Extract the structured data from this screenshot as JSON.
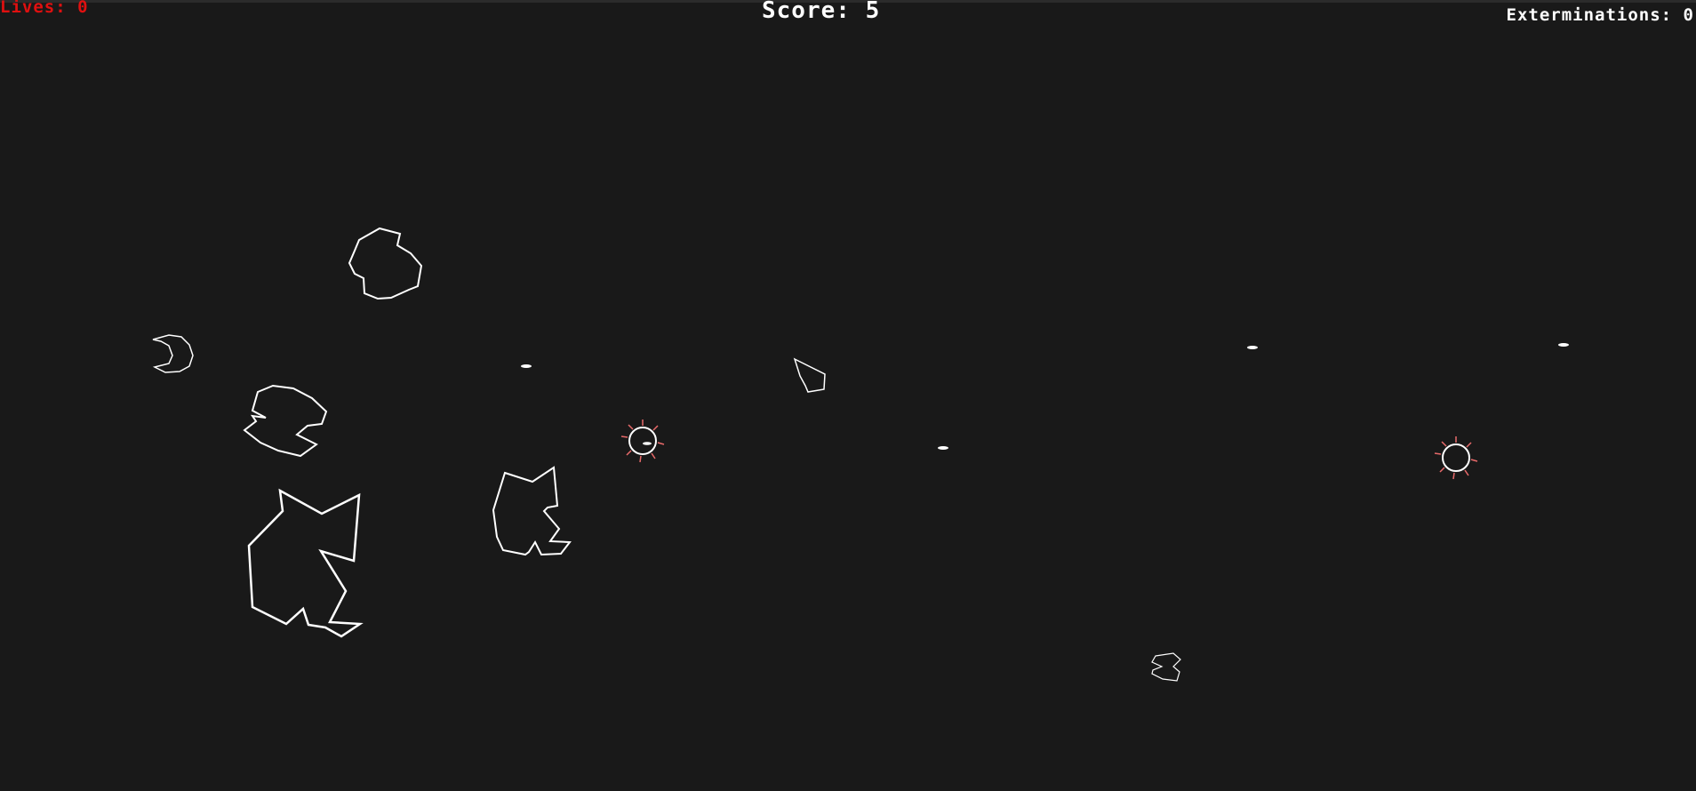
{
  "hud": {
    "lives_label": "Lives:",
    "lives_value": "0",
    "lives_text": "Lives: 0",
    "score_text": "Score: 5",
    "score_value": 5,
    "exterminations_text": "Exterminations: 0",
    "exterminations_value": 0
  },
  "colors": {
    "background": "#191919",
    "lives_text": "#e01010",
    "hud_text": "#ffffff",
    "outline": "#ffffff",
    "mine_spike": "#e86a6a"
  },
  "entities": {
    "asteroids": [
      "asteroid",
      "asteroid",
      "asteroid",
      "asteroid",
      "asteroid",
      "asteroid",
      "asteroid",
      "asteroid"
    ],
    "bullets": [
      "bullet",
      "bullet",
      "bullet",
      "bullet",
      "bullet"
    ],
    "mines": [
      "spiked-mine",
      "spiked-mine"
    ]
  }
}
